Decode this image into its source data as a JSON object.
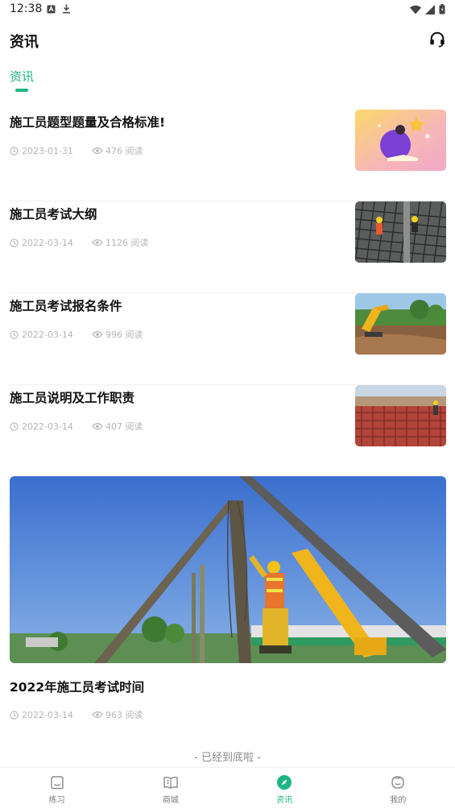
{
  "status_bar": {
    "time": "12:38"
  },
  "header": {
    "title": "资讯"
  },
  "tabs": [
    {
      "label": "资讯",
      "active": true
    }
  ],
  "articles": [
    {
      "title": "施工员题型题量及合格标准!",
      "date": "2023-01-31",
      "views": "476 阅读",
      "image": "illustration-person-book"
    },
    {
      "title": "施工员考试大纲",
      "date": "2022-03-14",
      "views": "1126 阅读",
      "image": "rebar-workers"
    },
    {
      "title": "施工员考试报名条件",
      "date": "2022-03-14",
      "views": "996 阅读",
      "image": "excavator-site"
    },
    {
      "title": "施工员说明及工作职责",
      "date": "2022-03-14",
      "views": "407 阅读",
      "image": "rebar-formwork"
    }
  ],
  "featured_article": {
    "title": "2022年施工员考试时间",
    "date": "2022-03-14",
    "views": "963 阅读",
    "image": "pile-driver-worker"
  },
  "list_end_text": "- 已经到底啦 -",
  "bottom_nav": [
    {
      "label": "练习",
      "icon": "practice-icon",
      "active": false
    },
    {
      "label": "商城",
      "icon": "book-icon",
      "active": false
    },
    {
      "label": "资讯",
      "icon": "compass-icon",
      "active": true
    },
    {
      "label": "我的",
      "icon": "profile-icon",
      "active": false
    }
  ],
  "colors": {
    "accent": "#1db584",
    "meta_text": "#b5b5b5",
    "title_text": "#111111"
  }
}
